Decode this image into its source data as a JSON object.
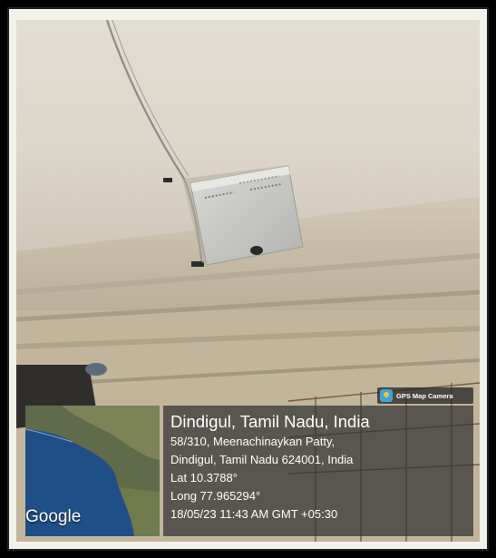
{
  "stamp": {
    "app_badge": "GPS Map Camera",
    "map_brand": "Google",
    "title": "Dindigul, Tamil Nadu, India",
    "address_line1": "58/310, Meenachinaykan Patty,",
    "address_line2": "Dindigul, Tamil Nadu 624001, India",
    "lat": "Lat 10.3788°",
    "long": "Long 77.965294°",
    "datetime": "18/05/23 11:43 AM GMT +05:30"
  },
  "colors": {
    "frame": "#000000",
    "ceiling": "#d8d2c6",
    "wall": "#cbbfa9",
    "device": "#c9c9c6",
    "stamp_panel": "#343434",
    "map_sea": "#1f4f86",
    "map_land": "#5f6b4a"
  }
}
